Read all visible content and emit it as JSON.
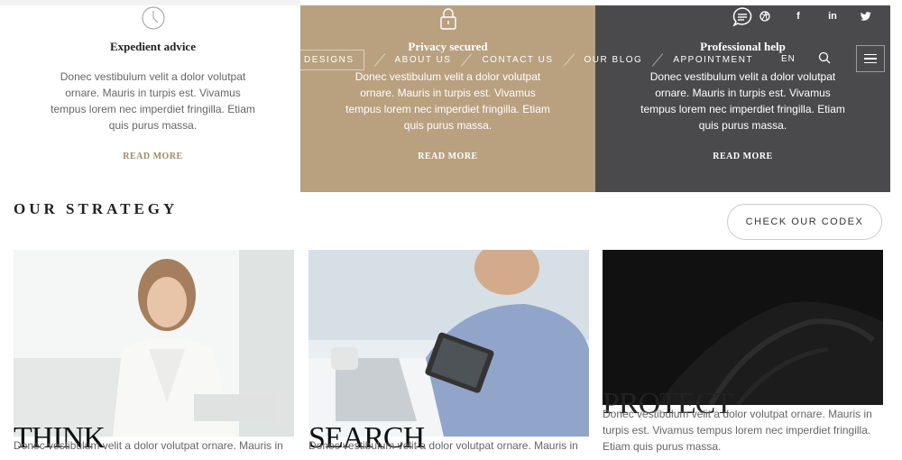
{
  "features": [
    {
      "title": "Expedient advice",
      "body": "Donec vestibulum velit a dolor volutpat ornare. Mauris in turpis est. Vivamus tempus lorem nec imperdiet fringilla. Etiam quis purus massa.",
      "more": "READ MORE",
      "icon": "clock-icon"
    },
    {
      "title": "Privacy secured",
      "body": "Donec vestibulum velit a dolor volutpat ornare. Mauris in turpis est. Vivamus tempus lorem nec imperdiet fringilla. Etiam quis purus massa.",
      "more": "READ MORE",
      "icon": "padlock-icon"
    },
    {
      "title": "Professional help",
      "body": "Donec vestibulum velit a dolor volutpat ornare. Mauris in turpis est. Vivamus tempus lorem nec imperdiet fringilla. Etiam quis purus massa.",
      "more": "READ MORE",
      "icon": "chat-bubble-icon"
    }
  ],
  "nav": {
    "items": [
      "DESIGNS",
      "ABOUT US",
      "CONTACT US",
      "OUR BLOG",
      "APPOINTMENT"
    ],
    "lang": "EN"
  },
  "social": {
    "dribbble": "dribbble-icon",
    "facebook": "f",
    "linkedin": "in",
    "twitter": "twitter-icon"
  },
  "strategy": {
    "heading": "OUR STRATEGY",
    "cta": "CHECK OUR CODEX",
    "cards": [
      {
        "title": "THINK",
        "text": "Donec vestibulum velit a dolor volutpat ornare. Mauris in"
      },
      {
        "title": "SEARCH",
        "text": "Donec vestibulum velit a dolor volutpat ornare. Mauris in"
      },
      {
        "title": "PROTECT",
        "text": "Donec vestibulum velit a dolor volutpat ornare. Mauris in turpis est. Vivamus tempus lorem nec imperdiet fringilla. Etiam quis purus massa."
      }
    ]
  },
  "colors": {
    "accent": "#b9a07f",
    "dark": "#4a4a4c",
    "more_link": "#9b8c68"
  }
}
